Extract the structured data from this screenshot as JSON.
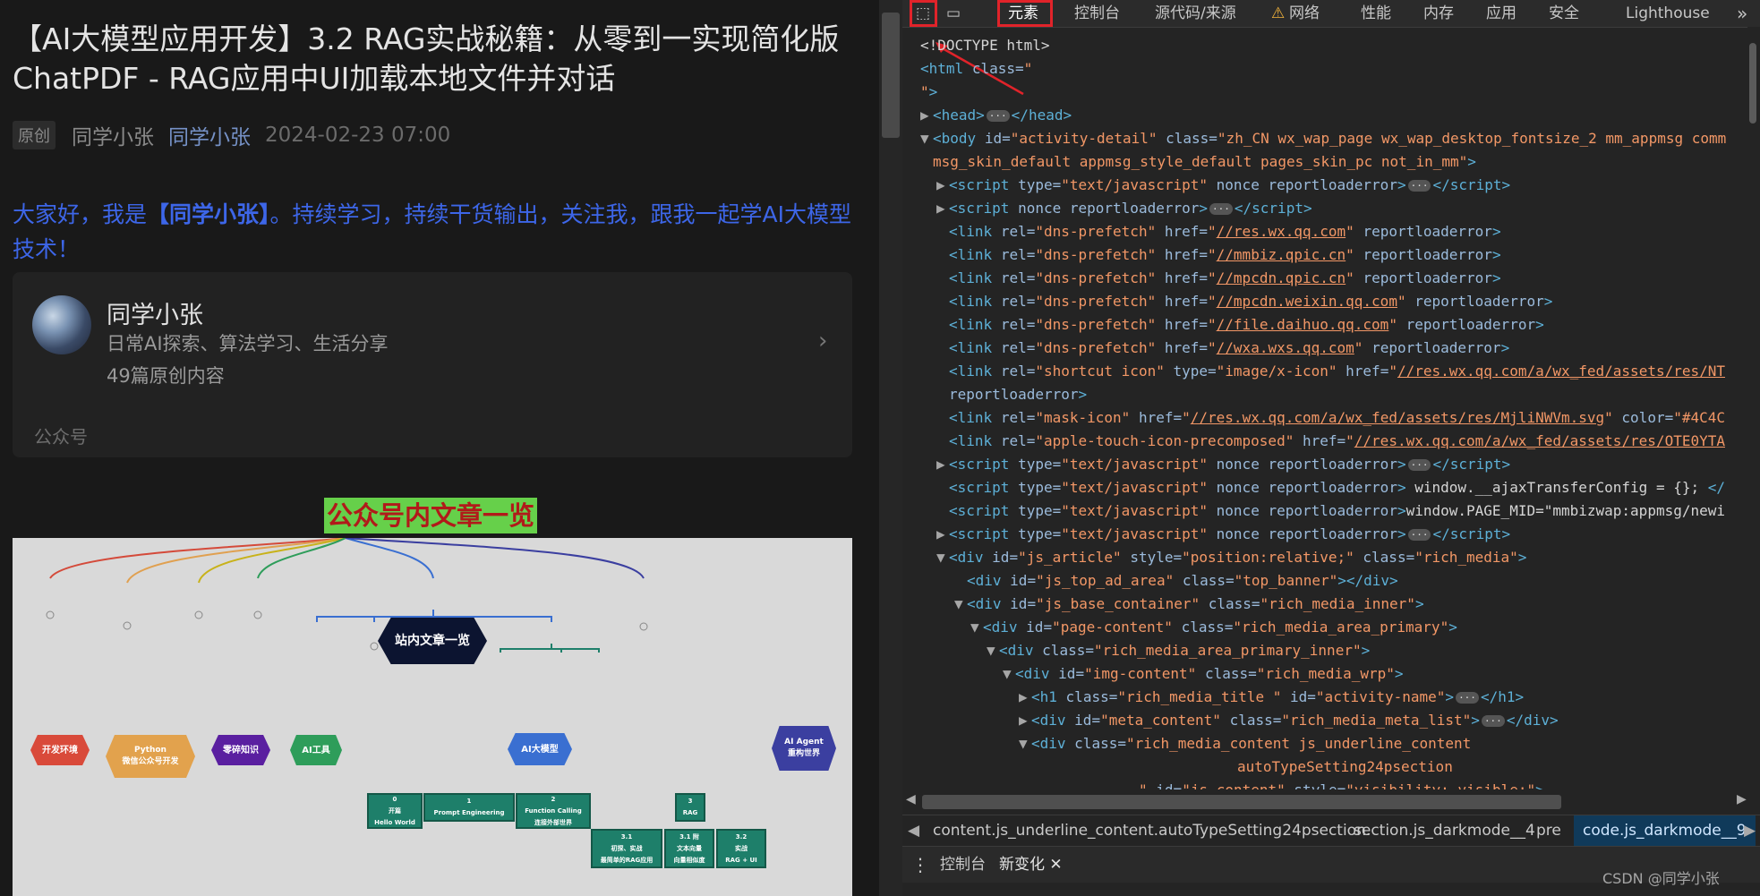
{
  "article": {
    "title": "【AI大模型应用开发】3.2 RAG实战秘籍：从零到一实现简化版ChatPDF - RAG应用中UI加载本地文件并对话",
    "original_badge": "原创",
    "author": "同学小张",
    "account_link": "同学小张",
    "date": "2024-02-23 07:00",
    "intro_prefix": "大家好，我是",
    "intro_bold": "【同学小张】",
    "intro_rest": "。持续学习，持续干货输出，关注我，跟我一起学AI大模型技术！",
    "profile_card": {
      "name": "同学小张",
      "description": "日常AI探索、算法学习、生活分享",
      "count": "49篇原创内容",
      "type": "公众号",
      "chevron_icon": "chevron-right-icon"
    },
    "highlight_heading": "公众号内文章一览",
    "mindmap": {
      "root": "站内文章一览",
      "branches": [
        "开发环境",
        "Python\n微信公众号开发",
        "零碎知识",
        "AI工具",
        "AI大模型",
        "AI Agent\n重构世界"
      ],
      "ai_children": [
        "0\n开篇\nHello World",
        "1\nPrompt Engineering",
        "2\nFunction Calling\n连接外部世界",
        "3\nRAG"
      ],
      "rag_children": [
        "3.1\n初探、实战\n最简单的RAG应用",
        "3.1 附\n文本向量\n向量相似度",
        "3.2\n实战\nRAG + UI"
      ]
    }
  },
  "devtools": {
    "toolbar": {
      "inspect_icon": "inspect-element-icon",
      "device_icon": "device-toggle-icon",
      "more_icon": "chevron-double-right-icon"
    },
    "tabs": [
      "元素",
      "控制台",
      "源代码/来源",
      "网络",
      "性能",
      "内存",
      "应用",
      "安全",
      "Lighthouse"
    ],
    "network_warning_icon": "warning-triangle-icon",
    "active_tab": "元素",
    "breadcrumbs": [
      "content.js_underline_content.autoTypeSetting24psection.",
      "section.js_darkmode__4",
      "pre",
      "code.js_darkmode__9"
    ],
    "drawer_tabs": [
      "控制台",
      "新变化"
    ],
    "drawer_menu_icon": "kebab-menu-icon",
    "drawer_close_icon": "close-icon",
    "watermark": "CSDN @同学小张"
  },
  "colors": {
    "accent_red": "#e1232a",
    "tag": "#5db0d7",
    "attr_value": "#f29766",
    "intro_blue": "#3d66e8",
    "highlight_green": "#66d04a"
  }
}
